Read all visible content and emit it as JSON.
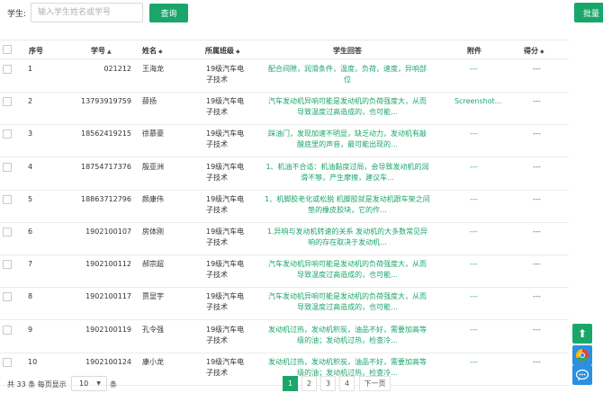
{
  "search": {
    "label": "学生:",
    "placeholder": "输入学生姓名或学号",
    "query_label": "查询",
    "batch_label": "批量"
  },
  "table": {
    "headers": {
      "seq": "序号",
      "student_no": "学号",
      "name": "姓名",
      "class": "所属班级",
      "answer": "学生回答",
      "attachment": "附件",
      "score": "得分"
    },
    "rows": [
      {
        "seq": "1",
        "student_no": "021212",
        "name": "王海龙",
        "class": [
          "19级汽车电",
          "子技术"
        ],
        "answer": [
          "配合间隙，润滑条件，温度，负荷，速度，异响部",
          "位"
        ],
        "attachment": "---",
        "score": "---"
      },
      {
        "seq": "2",
        "student_no": "13793919759",
        "name": "薛扬",
        "class": [
          "19级汽车电",
          "子技术"
        ],
        "answer": [
          "汽车发动机异响可能是发动机的负荷强度大，从而",
          "导致温度过高造成的，也可能..."
        ],
        "attachment": "Screenshot...",
        "score": "---"
      },
      {
        "seq": "3",
        "student_no": "18562419215",
        "name": "徐慕豪",
        "class": [
          "19级汽车电",
          "子技术"
        ],
        "answer": [
          "踩油门，发现加速不明显，缺乏动力，发动机有敲",
          "酸底里的声音，最可能出现的..."
        ],
        "attachment": "---",
        "score": "---"
      },
      {
        "seq": "4",
        "student_no": "18754717376",
        "name": "殷亚洲",
        "class": [
          "19级汽车电",
          "子技术"
        ],
        "answer": [
          "1、机油不合适：机油黏度过局，会导致发动机的润",
          "滑不够，产生摩擦，建议车..."
        ],
        "attachment": "---",
        "score": "---"
      },
      {
        "seq": "5",
        "student_no": "18863712796",
        "name": "颜康伟",
        "class": [
          "19级汽车电",
          "子技术"
        ],
        "answer": [
          "1、机脚胶老化或松脱 机脚胶就是发动机跟车架之间",
          "垫的橡皮胶块，它的作..."
        ],
        "attachment": "---",
        "score": "---"
      },
      {
        "seq": "6",
        "student_no": "1902100107",
        "name": "房体刚",
        "class": [
          "19级汽车电",
          "子技术"
        ],
        "answer": [
          "1.异响与发动机转速的关系 发动机的大多数常见异",
          "响的存在取决于发动机..."
        ],
        "attachment": "---",
        "score": "---"
      },
      {
        "seq": "7",
        "student_no": "1902100112",
        "name": "郝宗超",
        "class": [
          "19级汽车电",
          "子技术"
        ],
        "answer": [
          "汽车发动机异响可能是发动机的负荷强度大，从而",
          "导致温度过高造成的，也可能..."
        ],
        "attachment": "---",
        "score": "---"
      },
      {
        "seq": "8",
        "student_no": "1902100117",
        "name": "贾显宇",
        "class": [
          "19级汽车电",
          "子技术"
        ],
        "answer": [
          "汽车发动机异响可能是发动机的负荷强度大，从而",
          "导致温度过高造成的，也可能..."
        ],
        "attachment": "---",
        "score": "---"
      },
      {
        "seq": "9",
        "student_no": "1902100119",
        "name": "孔令强",
        "class": [
          "19级汽车电",
          "子技术"
        ],
        "answer": [
          "发动机过热，发动机积炭，油品不好，需要加高等",
          "级的油；发动机过热，检查冷..."
        ],
        "attachment": "---",
        "score": "---"
      },
      {
        "seq": "10",
        "student_no": "1902100124",
        "name": "康小龙",
        "class": [
          "19级汽车电",
          "子技术"
        ],
        "answer": [
          "发动机过热，发动机积炭，油品不好，需要加高等",
          "级的油；发动机过热，检查冷..."
        ],
        "attachment": "---",
        "score": "---"
      }
    ]
  },
  "pagination": {
    "total_text": "共 33 条 每页显示",
    "page_size": "10",
    "unit": "条",
    "pages": [
      "1",
      "2",
      "3",
      "4"
    ],
    "next_label": "下一页",
    "current_page": "1"
  },
  "colors": {
    "accent": "#1aa66b",
    "side_blue": "#2c8fe0"
  },
  "icons": {
    "back_to_top": "arrow-up-icon",
    "chrome": "chrome-icon",
    "chat": "chat-icon",
    "sort_asc": "sort-asc-icon",
    "sort_both": "sort-icon",
    "select_caret": "chevron-down-icon"
  }
}
